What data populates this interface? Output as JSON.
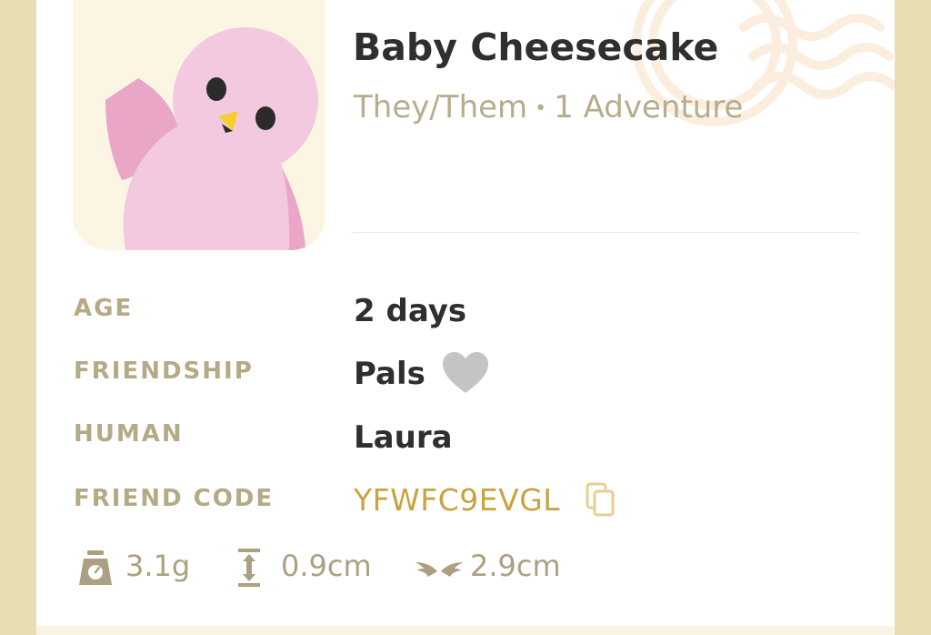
{
  "pet": {
    "name": "Baby Cheesecake",
    "pronouns": "They/Them",
    "separator": "•",
    "adventures": "1 Adventure",
    "avatar_icon": "pink-bird-icon"
  },
  "details": {
    "age_label": "AGE",
    "age_value": "2 days",
    "friendship_label": "FRIENDSHIP",
    "friendship_value": "Pals",
    "friendship_icon": "heart-icon",
    "human_label": "HUMAN",
    "human_value": "Laura",
    "friend_code_label": "FRIEND CODE",
    "friend_code_value": "YFWFC9EVGL",
    "copy_icon": "copy-icon"
  },
  "stats": {
    "weight": "3.1g",
    "weight_icon": "scale-icon",
    "height": "0.9cm",
    "height_icon": "height-icon",
    "wingspan": "2.9cm",
    "wingspan_icon": "wings-icon"
  },
  "colors": {
    "page_bg": "#e9ddb4",
    "card_bg": "#ffffff",
    "label": "#b4aa85",
    "value": "#2f2f2f",
    "subtle": "#b6ad8e",
    "code": "#c7a43e",
    "heart": "#c4c4c4",
    "bird": "#f2c9de"
  }
}
